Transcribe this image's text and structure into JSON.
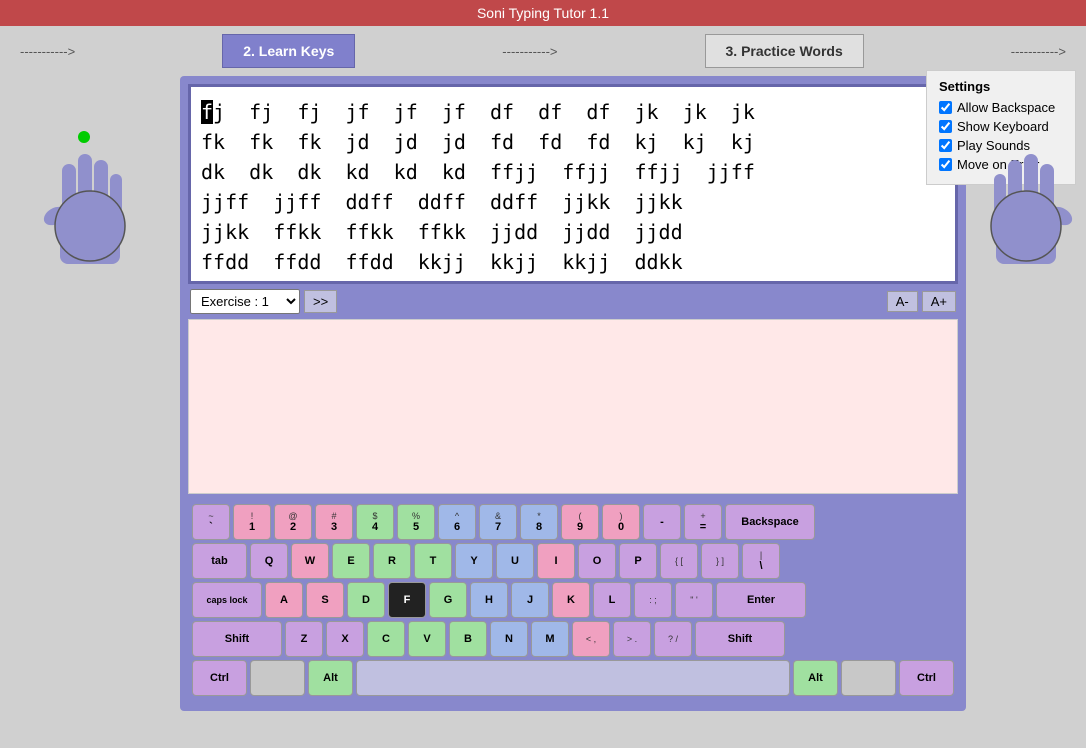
{
  "title": "Soni Typing Tutor 1.1",
  "nav": {
    "arrow1": "----------->",
    "step2": "2. Learn Keys",
    "arrow2": "----------->",
    "step3": "3. Practice Words",
    "arrow3": "----------->",
    "arrow0": "----------->",
    "arrow4": "----------->",
    "arrow00": "----------->",
    "arrow44": "----------->"
  },
  "text_display": "fj  fj  fj  jf  jf  jf  df  df  df  jk  jk  jk\nfk  fk  fk  jd  jd  jd  fd  fd  fd  kj  kj  kj\ndk  dk  dk  kd  kd  kd  ffjj  ffjj  ffjj  jjff\njjff  jjff  ddff  ddff  ddff  jjkk  jjkk\njjkk  ffkk  ffkk  ffkk  jjdd  jjdd  jjdd\nffdd  ffdd  ffdd  kkjj  kkjj  kkjj  ddkk",
  "exercise_label": "Exercise : 1",
  "next_btn": ">>",
  "font_minus": "A-",
  "font_plus": "A+",
  "settings": {
    "title": "Settings",
    "allow_backspace": "Allow Backspace",
    "show_keyboard": "Show Keyboard",
    "play_sounds": "Play Sounds",
    "move_on_error": "Move on Error"
  },
  "keyboard": {
    "row1": [
      {
        "top": "~",
        "bottom": "`",
        "color": "purple"
      },
      {
        "top": "!",
        "bottom": "1",
        "color": "pink"
      },
      {
        "top": "@",
        "bottom": "2",
        "color": "pink"
      },
      {
        "top": "#",
        "bottom": "3",
        "color": "pink"
      },
      {
        "top": "$",
        "bottom": "4",
        "color": "green"
      },
      {
        "top": "%",
        "bottom": "5",
        "color": "green"
      },
      {
        "top": "^",
        "bottom": "6",
        "color": "blue"
      },
      {
        "top": "&",
        "bottom": "7",
        "color": "blue"
      },
      {
        "top": "*",
        "bottom": "8",
        "color": "blue"
      },
      {
        "top": "(",
        "bottom": "9",
        "color": "pink"
      },
      {
        "top": ")",
        "bottom": "0",
        "color": "pink"
      },
      {
        "top": "",
        "bottom": "-",
        "color": "purple"
      },
      {
        "top": "",
        "bottom": "=",
        "color": "purple"
      },
      {
        "top": "",
        "bottom": "Backspace",
        "color": "purple",
        "wide": "backspace"
      }
    ],
    "row2": [
      {
        "top": "",
        "bottom": "tab",
        "color": "purple",
        "wide": "tab"
      },
      {
        "top": "",
        "bottom": "Q",
        "color": "purple"
      },
      {
        "top": "",
        "bottom": "W",
        "color": "pink"
      },
      {
        "top": "",
        "bottom": "E",
        "color": "green"
      },
      {
        "top": "",
        "bottom": "R",
        "color": "green"
      },
      {
        "top": "",
        "bottom": "T",
        "color": "green"
      },
      {
        "top": "",
        "bottom": "Y",
        "color": "blue"
      },
      {
        "top": "",
        "bottom": "U",
        "color": "blue"
      },
      {
        "top": "",
        "bottom": "I",
        "color": "pink"
      },
      {
        "top": "",
        "bottom": "O",
        "color": "purple"
      },
      {
        "top": "",
        "bottom": "P",
        "color": "purple"
      },
      {
        "top": "{ [",
        "bottom": "",
        "color": "purple"
      },
      {
        "top": "} ]",
        "bottom": "",
        "color": "purple"
      },
      {
        "top": "| \\",
        "bottom": "",
        "color": "purple"
      }
    ],
    "row3": [
      {
        "top": "",
        "bottom": "caps lock",
        "color": "purple",
        "wide": "capslock"
      },
      {
        "top": "",
        "bottom": "A",
        "color": "pink"
      },
      {
        "top": "",
        "bottom": "S",
        "color": "pink"
      },
      {
        "top": "",
        "bottom": "D",
        "color": "green"
      },
      {
        "top": "",
        "bottom": "F",
        "color": "black"
      },
      {
        "top": "",
        "bottom": "G",
        "color": "green"
      },
      {
        "top": "",
        "bottom": "H",
        "color": "blue"
      },
      {
        "top": "",
        "bottom": "J",
        "color": "blue"
      },
      {
        "top": "",
        "bottom": "K",
        "color": "pink"
      },
      {
        "top": "",
        "bottom": "L",
        "color": "purple"
      },
      {
        "top": ": ;",
        "bottom": "",
        "color": "purple"
      },
      {
        "top": "\" '",
        "bottom": "",
        "color": "purple"
      },
      {
        "top": "",
        "bottom": "Enter",
        "color": "purple",
        "wide": "enter"
      }
    ],
    "row4": [
      {
        "top": "",
        "bottom": "Shift",
        "color": "purple",
        "wide": "shift-l"
      },
      {
        "top": "",
        "bottom": "Z",
        "color": "purple"
      },
      {
        "top": "",
        "bottom": "X",
        "color": "purple"
      },
      {
        "top": "",
        "bottom": "C",
        "color": "green"
      },
      {
        "top": "",
        "bottom": "V",
        "color": "green"
      },
      {
        "top": "",
        "bottom": "B",
        "color": "green"
      },
      {
        "top": "",
        "bottom": "N",
        "color": "blue"
      },
      {
        "top": "",
        "bottom": "M",
        "color": "blue"
      },
      {
        "top": "< ,",
        "bottom": "",
        "color": "pink"
      },
      {
        "top": "> .",
        "bottom": "",
        "color": "purple"
      },
      {
        "top": "? /",
        "bottom": "",
        "color": "purple"
      },
      {
        "top": "",
        "bottom": "Shift",
        "color": "purple",
        "wide": "shift-r"
      }
    ],
    "row5": [
      {
        "top": "",
        "bottom": "Ctrl",
        "color": "purple",
        "wide": "ctrl"
      },
      {
        "top": "",
        "bottom": "",
        "color": "gray",
        "wide": "wider"
      },
      {
        "top": "",
        "bottom": "Alt",
        "color": "green",
        "wide": "alt"
      },
      {
        "top": "",
        "bottom": "",
        "color": "gray",
        "wide": "space"
      },
      {
        "top": "",
        "bottom": "Alt",
        "color": "green",
        "wide": "alt"
      },
      {
        "top": "",
        "bottom": "",
        "color": "gray",
        "wide": "wider"
      },
      {
        "top": "",
        "bottom": "Ctrl",
        "color": "purple",
        "wide": "ctrl"
      }
    ]
  }
}
